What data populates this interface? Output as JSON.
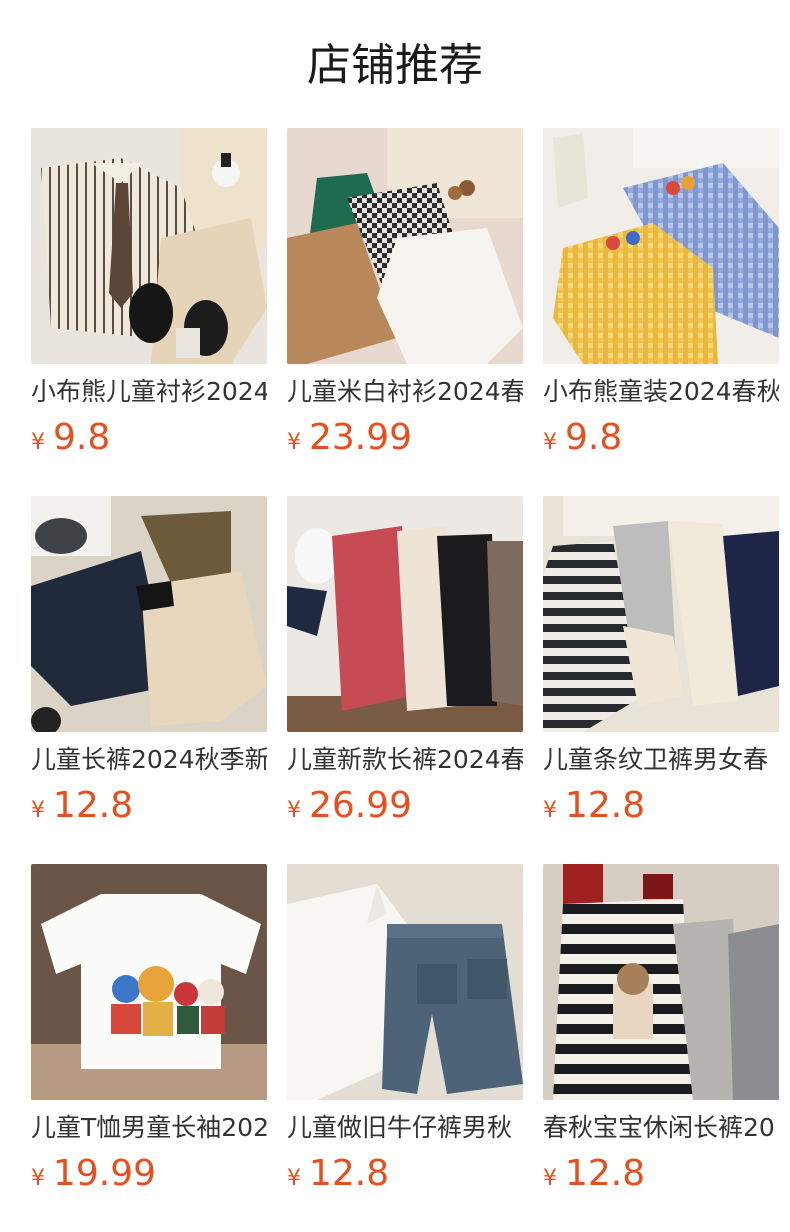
{
  "section": {
    "title": "店铺推荐"
  },
  "currency": "¥",
  "products": [
    {
      "name": "小布熊儿童衬衫2024",
      "price": "9.8",
      "icon": "product-photo-striped-shirt-tie"
    },
    {
      "name": "儿童米白衬衫2024春",
      "price": "23.99",
      "icon": "product-photo-shirts-plaid"
    },
    {
      "name": "小布熊童装2024春秋",
      "price": "9.8",
      "icon": "product-photo-gingham-shirts"
    },
    {
      "name": "儿童长裤2024秋季新",
      "price": "12.8",
      "icon": "product-photo-cargo-pants"
    },
    {
      "name": "儿童新款长裤2024春",
      "price": "26.99",
      "icon": "product-photo-colored-pants"
    },
    {
      "name": "儿童条纹卫裤男女春",
      "price": "12.8",
      "icon": "product-photo-sweatpants"
    },
    {
      "name": "儿童T恤男童长袖202",
      "price": "19.99",
      "icon": "product-photo-bear-tshirt"
    },
    {
      "name": "儿童做旧牛仔裤男秋",
      "price": "12.8",
      "icon": "product-photo-denim-jeans"
    },
    {
      "name": "春秋宝宝休闲长裤20",
      "price": "12.8",
      "icon": "product-photo-striped-pants"
    }
  ]
}
